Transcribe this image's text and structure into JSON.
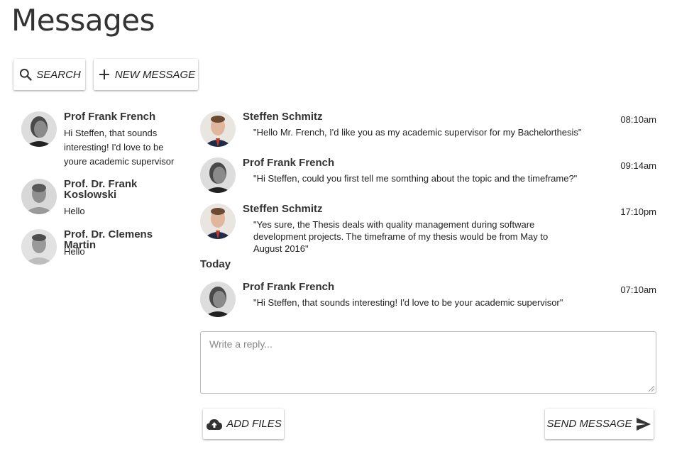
{
  "page": {
    "title": "Messages"
  },
  "toolbar": {
    "search_label": "SEARCH",
    "new_message_label": "NEW MESSAGE"
  },
  "conversations": [
    {
      "name": "Prof Frank French",
      "snippet": "Hi Steffen, that sounds interesting! I'd love to be youre academic supervisor",
      "avatar": "frank-french-photo"
    },
    {
      "name": "Prof. Dr. Frank Koslowski",
      "snippet": "Hello",
      "avatar": "frank-koslowski-photo"
    },
    {
      "name": "Prof. Dr. Clemens Martin",
      "snippet": "Hello",
      "avatar": "clemens-martin-photo"
    }
  ],
  "messages": [
    {
      "sender": "Steffen Schmitz",
      "time": "08:10am",
      "text": "\"Hello Mr. French, I'd like you as my academic supervisor for my Bachelorthesis\"",
      "avatar": "steffen-schmitz-photo"
    },
    {
      "sender": "Prof Frank French",
      "time": "09:14am",
      "text": "\"Hi Steffen, could you first tell me somthing about the topic and the timeframe?\"",
      "avatar": "frank-french-photo"
    },
    {
      "sender": "Steffen Schmitz",
      "time": "17:10pm",
      "text": "\"Yes sure, the Thesis deals with quality management during software development projects. The timeframe of my thesis would be from May to August 2016\"",
      "avatar": "steffen-schmitz-photo"
    }
  ],
  "today_label": "Today",
  "today_messages": [
    {
      "sender": "Prof Frank French",
      "time": "07:10am",
      "text": "\"Hi Steffen, that sounds interesting! I'd love to be your academic supervisor\"",
      "avatar": "frank-french-photo"
    }
  ],
  "reply": {
    "placeholder": "Write a reply...",
    "value": ""
  },
  "actions": {
    "add_files_label": "ADD FILES",
    "send_label": "SEND MESSAGE"
  },
  "icons": {
    "search": "search-icon",
    "plus": "plus-icon",
    "upload": "cloud-upload-icon",
    "send": "send-icon"
  }
}
